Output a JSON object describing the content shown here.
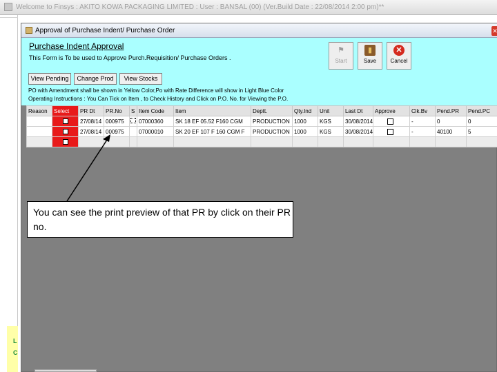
{
  "app": {
    "title": "Welcome to Finsys : AKITO KOWA PACKAGING LIMITED : User : BANSAL (00) (Ver.Build Date : 22/08/2014 2:00 pm)**"
  },
  "left_strip": {
    "chars": [
      "L",
      "C"
    ]
  },
  "dialog": {
    "title": "Approval of Purchase Indent/ Purchase Order"
  },
  "form": {
    "title": "Purchase Indent Approval",
    "subtitle": "This Form is To be used to Approve Purch.Requisition/ Purchase Orders .",
    "toolbar": {
      "start_label": "Start",
      "save_label": "Save",
      "cancel_label": "Cancel"
    },
    "buttons": {
      "view_pending": "View Pending",
      "change_prod": "Change Prod",
      "view_stocks": "View Stocks"
    },
    "note_line1": "PO with Amendment shall be shown in Yellow Color,Po with Rate Difference will show in Light Blue Color",
    "note_line2": "Operating Instructions : You Can Tick on Item , to Check History  and Click on P.O. No. for Viewing the P.O."
  },
  "grid": {
    "columns": [
      "Reason",
      "Select",
      "PR Dt",
      "PR.No",
      "S",
      "Item Code",
      "Item",
      "Deptt.",
      "Qty.Ind",
      "Unit",
      "Last Dt",
      "Approve",
      "Clk.Bv",
      "Pend.PR",
      "Pend.PC"
    ],
    "rows": [
      {
        "pr_dt": "27/08/14",
        "pr_no": "000975",
        "item_code": "07000360",
        "item": "SK 18 EF 05.52 F160 CGM",
        "deptt": "PRODUCTION",
        "qty": "1000",
        "unit": "KGS",
        "last_dt": "30/08/2014",
        "clk": "-",
        "pend_pr": "0",
        "pend_pc": "0"
      },
      {
        "pr_dt": "27/08/14",
        "pr_no": "000975",
        "item_code": "07000010",
        "item": "SK 20 EF 107 F 160 CGM F",
        "deptt": "PRODUCTION",
        "qty": "1000",
        "unit": "KGS",
        "last_dt": "30/08/2014",
        "clk": "-",
        "pend_pr": "40100",
        "pend_pc": "5"
      }
    ]
  },
  "callout": {
    "text": "You can see the print preview of that PR by click on their PR no."
  },
  "colors": {
    "form_bg": "#aaffff",
    "select_red": "#e81a1a",
    "grid_empty": "#808080"
  }
}
